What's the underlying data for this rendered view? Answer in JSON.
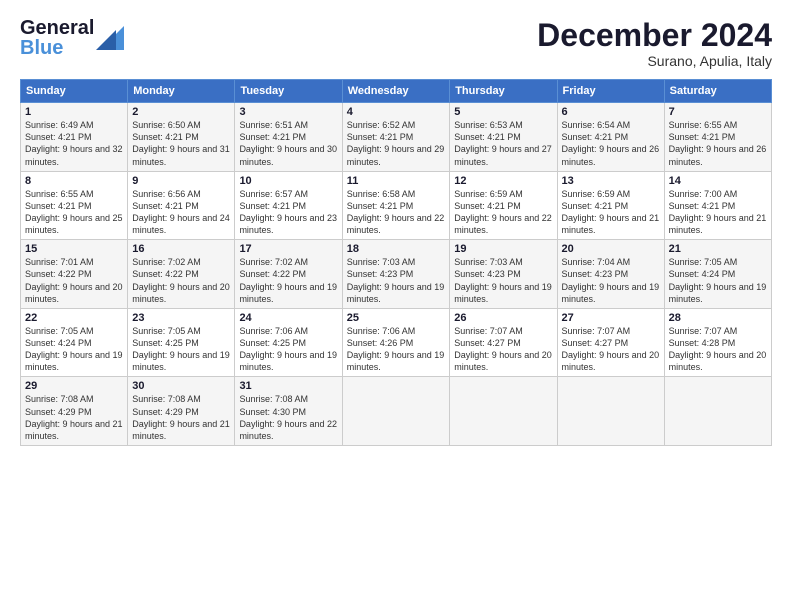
{
  "header": {
    "month_title": "December 2024",
    "location": "Surano, Apulia, Italy"
  },
  "days": [
    "Sunday",
    "Monday",
    "Tuesday",
    "Wednesday",
    "Thursday",
    "Friday",
    "Saturday"
  ],
  "weeks": [
    [
      {
        "day": "1",
        "sunrise": "Sunrise: 6:49 AM",
        "sunset": "Sunset: 4:21 PM",
        "daylight": "Daylight: 9 hours and 32 minutes."
      },
      {
        "day": "2",
        "sunrise": "Sunrise: 6:50 AM",
        "sunset": "Sunset: 4:21 PM",
        "daylight": "Daylight: 9 hours and 31 minutes."
      },
      {
        "day": "3",
        "sunrise": "Sunrise: 6:51 AM",
        "sunset": "Sunset: 4:21 PM",
        "daylight": "Daylight: 9 hours and 30 minutes."
      },
      {
        "day": "4",
        "sunrise": "Sunrise: 6:52 AM",
        "sunset": "Sunset: 4:21 PM",
        "daylight": "Daylight: 9 hours and 29 minutes."
      },
      {
        "day": "5",
        "sunrise": "Sunrise: 6:53 AM",
        "sunset": "Sunset: 4:21 PM",
        "daylight": "Daylight: 9 hours and 27 minutes."
      },
      {
        "day": "6",
        "sunrise": "Sunrise: 6:54 AM",
        "sunset": "Sunset: 4:21 PM",
        "daylight": "Daylight: 9 hours and 26 minutes."
      },
      {
        "day": "7",
        "sunrise": "Sunrise: 6:55 AM",
        "sunset": "Sunset: 4:21 PM",
        "daylight": "Daylight: 9 hours and 26 minutes."
      }
    ],
    [
      {
        "day": "8",
        "sunrise": "Sunrise: 6:55 AM",
        "sunset": "Sunset: 4:21 PM",
        "daylight": "Daylight: 9 hours and 25 minutes."
      },
      {
        "day": "9",
        "sunrise": "Sunrise: 6:56 AM",
        "sunset": "Sunset: 4:21 PM",
        "daylight": "Daylight: 9 hours and 24 minutes."
      },
      {
        "day": "10",
        "sunrise": "Sunrise: 6:57 AM",
        "sunset": "Sunset: 4:21 PM",
        "daylight": "Daylight: 9 hours and 23 minutes."
      },
      {
        "day": "11",
        "sunrise": "Sunrise: 6:58 AM",
        "sunset": "Sunset: 4:21 PM",
        "daylight": "Daylight: 9 hours and 22 minutes."
      },
      {
        "day": "12",
        "sunrise": "Sunrise: 6:59 AM",
        "sunset": "Sunset: 4:21 PM",
        "daylight": "Daylight: 9 hours and 22 minutes."
      },
      {
        "day": "13",
        "sunrise": "Sunrise: 6:59 AM",
        "sunset": "Sunset: 4:21 PM",
        "daylight": "Daylight: 9 hours and 21 minutes."
      },
      {
        "day": "14",
        "sunrise": "Sunrise: 7:00 AM",
        "sunset": "Sunset: 4:21 PM",
        "daylight": "Daylight: 9 hours and 21 minutes."
      }
    ],
    [
      {
        "day": "15",
        "sunrise": "Sunrise: 7:01 AM",
        "sunset": "Sunset: 4:22 PM",
        "daylight": "Daylight: 9 hours and 20 minutes."
      },
      {
        "day": "16",
        "sunrise": "Sunrise: 7:02 AM",
        "sunset": "Sunset: 4:22 PM",
        "daylight": "Daylight: 9 hours and 20 minutes."
      },
      {
        "day": "17",
        "sunrise": "Sunrise: 7:02 AM",
        "sunset": "Sunset: 4:22 PM",
        "daylight": "Daylight: 9 hours and 19 minutes."
      },
      {
        "day": "18",
        "sunrise": "Sunrise: 7:03 AM",
        "sunset": "Sunset: 4:23 PM",
        "daylight": "Daylight: 9 hours and 19 minutes."
      },
      {
        "day": "19",
        "sunrise": "Sunrise: 7:03 AM",
        "sunset": "Sunset: 4:23 PM",
        "daylight": "Daylight: 9 hours and 19 minutes."
      },
      {
        "day": "20",
        "sunrise": "Sunrise: 7:04 AM",
        "sunset": "Sunset: 4:23 PM",
        "daylight": "Daylight: 9 hours and 19 minutes."
      },
      {
        "day": "21",
        "sunrise": "Sunrise: 7:05 AM",
        "sunset": "Sunset: 4:24 PM",
        "daylight": "Daylight: 9 hours and 19 minutes."
      }
    ],
    [
      {
        "day": "22",
        "sunrise": "Sunrise: 7:05 AM",
        "sunset": "Sunset: 4:24 PM",
        "daylight": "Daylight: 9 hours and 19 minutes."
      },
      {
        "day": "23",
        "sunrise": "Sunrise: 7:05 AM",
        "sunset": "Sunset: 4:25 PM",
        "daylight": "Daylight: 9 hours and 19 minutes."
      },
      {
        "day": "24",
        "sunrise": "Sunrise: 7:06 AM",
        "sunset": "Sunset: 4:25 PM",
        "daylight": "Daylight: 9 hours and 19 minutes."
      },
      {
        "day": "25",
        "sunrise": "Sunrise: 7:06 AM",
        "sunset": "Sunset: 4:26 PM",
        "daylight": "Daylight: 9 hours and 19 minutes."
      },
      {
        "day": "26",
        "sunrise": "Sunrise: 7:07 AM",
        "sunset": "Sunset: 4:27 PM",
        "daylight": "Daylight: 9 hours and 20 minutes."
      },
      {
        "day": "27",
        "sunrise": "Sunrise: 7:07 AM",
        "sunset": "Sunset: 4:27 PM",
        "daylight": "Daylight: 9 hours and 20 minutes."
      },
      {
        "day": "28",
        "sunrise": "Sunrise: 7:07 AM",
        "sunset": "Sunset: 4:28 PM",
        "daylight": "Daylight: 9 hours and 20 minutes."
      }
    ],
    [
      {
        "day": "29",
        "sunrise": "Sunrise: 7:08 AM",
        "sunset": "Sunset: 4:29 PM",
        "daylight": "Daylight: 9 hours and 21 minutes."
      },
      {
        "day": "30",
        "sunrise": "Sunrise: 7:08 AM",
        "sunset": "Sunset: 4:29 PM",
        "daylight": "Daylight: 9 hours and 21 minutes."
      },
      {
        "day": "31",
        "sunrise": "Sunrise: 7:08 AM",
        "sunset": "Sunset: 4:30 PM",
        "daylight": "Daylight: 9 hours and 22 minutes."
      },
      null,
      null,
      null,
      null
    ]
  ]
}
